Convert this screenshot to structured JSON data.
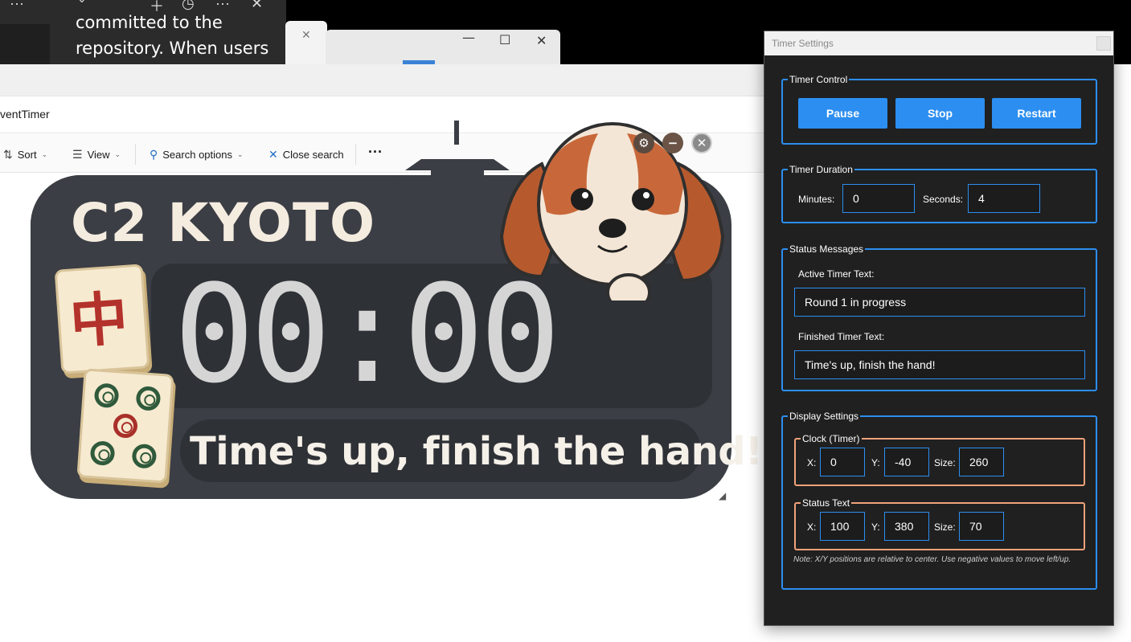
{
  "desktop": {
    "popup_text": "committed to the repository. When users",
    "popup_icons": [
      "more-icon",
      "chevron-down-icon",
      "add-icon",
      "history-icon",
      "more-icon",
      "close-icon"
    ]
  },
  "background_window": {
    "close": "✕",
    "minimize": "—",
    "maximize": "☐"
  },
  "explorer": {
    "address": "ventTimer",
    "toolbar": {
      "sort": "Sort",
      "view": "View",
      "search_options": "Search options",
      "close_search": "Close search",
      "more": "···"
    }
  },
  "timer_display": {
    "title": "C2 KYOTO",
    "clock": "00:00",
    "status": "Time's up, finish the hand!",
    "tile_character": "中"
  },
  "settings": {
    "window_title": "Timer Settings",
    "timer_control": {
      "legend": "Timer Control",
      "pause": "Pause",
      "stop": "Stop",
      "restart": "Restart"
    },
    "timer_duration": {
      "legend": "Timer Duration",
      "minutes_label": "Minutes:",
      "minutes_value": "0",
      "seconds_label": "Seconds:",
      "seconds_value": "4"
    },
    "status_messages": {
      "legend": "Status Messages",
      "active_label": "Active Timer Text:",
      "active_value": "Round 1 in progress",
      "finished_label": "Finished Timer Text:",
      "finished_value": "Time's up, finish the hand!"
    },
    "display_settings": {
      "legend": "Display Settings",
      "clock": {
        "legend": "Clock (Timer)",
        "x_label": "X:",
        "x": "0",
        "y_label": "Y:",
        "y": "-40",
        "size_label": "Size:",
        "size": "260"
      },
      "status_text": {
        "legend": "Status Text",
        "x_label": "X:",
        "x": "100",
        "y_label": "Y:",
        "y": "380",
        "size_label": "Size:",
        "size": "70"
      },
      "note": "Note: X/Y positions are relative to center. Use negative values to move left/up."
    }
  },
  "colors": {
    "accent_blue": "#2c8ef0",
    "subgroup_orange": "#f0a27a",
    "settings_bg": "#202020",
    "timer_card": "#3b3e44",
    "tile_red": "#b3322b",
    "tile_green": "#2f5a3b"
  }
}
